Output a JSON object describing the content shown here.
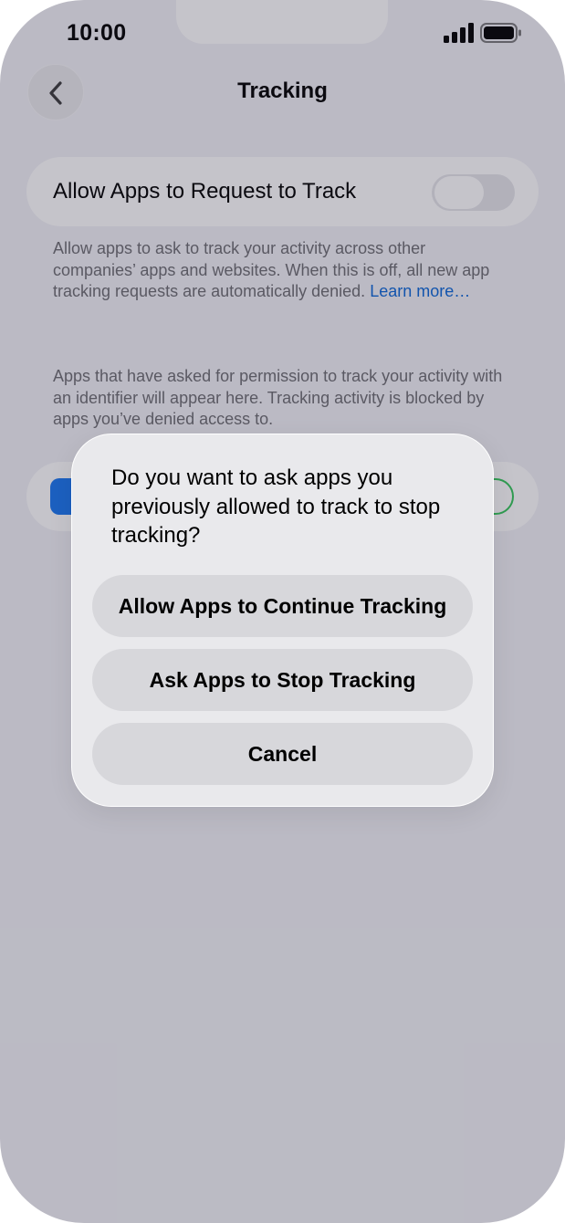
{
  "status_bar": {
    "time": "10:00",
    "signal_icon": "cellular-signal-icon",
    "battery_icon": "battery-full-icon"
  },
  "nav": {
    "title": "Tracking",
    "back_icon": "chevron-left-icon"
  },
  "settings": {
    "allow_request_label": "Allow Apps to Request to Track",
    "allow_request_on": false,
    "description": "Allow apps to ask to track your activity across other companies’ apps and websites. When this is off, all new app tracking requests are automatically denied. ",
    "learn_more": "Learn more…",
    "apps_note": "Apps that have asked for permission to track your activity with an identifier will appear here. Tracking activity is blocked by apps you’ve denied access to.",
    "app_row": {
      "icon": "facebook-app-icon",
      "toggle_on": true
    }
  },
  "alert": {
    "message": "Do you want to ask apps you previously allowed to track to stop tracking?",
    "buttons": {
      "continue": "Allow Apps to Continue Tracking",
      "stop": "Ask Apps to Stop Tracking",
      "cancel": "Cancel"
    }
  },
  "colors": {
    "link": "#0a66d8",
    "toggle_on": "#34c759",
    "facebook": "#1877f2"
  }
}
